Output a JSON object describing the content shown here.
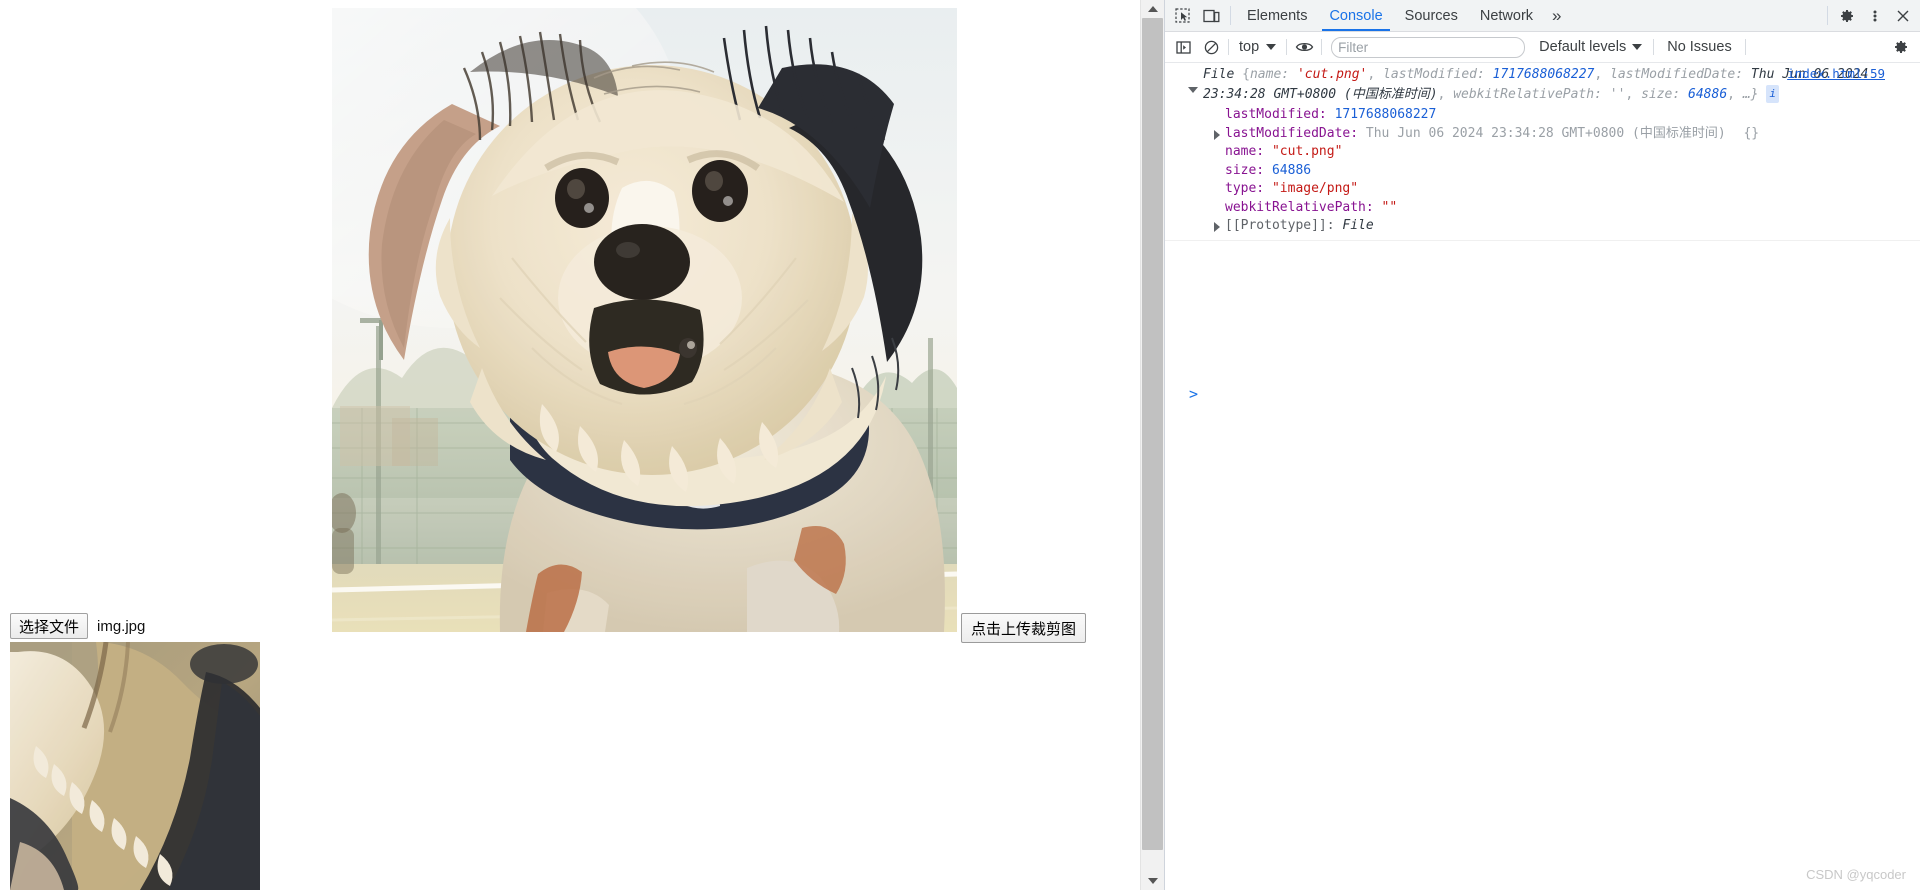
{
  "page": {
    "file_input": {
      "button_label": "选择文件",
      "file_name": "img.jpg"
    },
    "upload_button_label": "点击上传裁剪图",
    "main_image_alt": "cropped-dog-photo",
    "preview_image_alt": "cropped-preview"
  },
  "devtools": {
    "tabs": [
      {
        "label": "Elements",
        "active": false
      },
      {
        "label": "Console",
        "active": true
      },
      {
        "label": "Sources",
        "active": false
      },
      {
        "label": "Network",
        "active": false
      }
    ],
    "more_tabs_label": "»",
    "icons": {
      "inspect": "inspect-element-icon",
      "device": "device-toolbar-icon",
      "settings": "gear-icon",
      "kebab": "more-options-icon",
      "close": "close-icon",
      "sidebar": "console-sidebar-icon",
      "clear": "clear-console-icon",
      "eye": "live-expression-icon",
      "console_settings": "console-settings-gear-icon"
    },
    "console_toolbar": {
      "context": "top",
      "filter_placeholder": "Filter",
      "filter_value": "",
      "levels": "Default levels",
      "issues": "No Issues"
    },
    "console": {
      "source_link": "index.html:59",
      "summary": {
        "constructor": "File",
        "open_brace": "{",
        "k_name": "name:",
        "v_name": "'cut.png'",
        "sep1": ",",
        "k_lastModified": "lastModified:",
        "v_lastModified": "1717688068227",
        "sep2": ",",
        "k_lastModifiedDate": "lastModifiedDate:",
        "v_lastModifiedDate": "Thu Jun 06 2024 23:34:28 GMT+0800 (中国标准时间)",
        "sep3": ",",
        "k_webkitRelativePath": "webkitRelativePath:",
        "v_webkitRelativePath": "''",
        "sep4": ",",
        "k_size": "size:",
        "v_size": "64886",
        "sep5": ",",
        "ellipsis": "…}",
        "badge": "i"
      },
      "properties": [
        {
          "name": "lastModified:",
          "value": "1717688068227",
          "value_class": "v-num",
          "expandable": false,
          "suffix": ""
        },
        {
          "name": "lastModifiedDate:",
          "value": "Thu Jun 06 2024 23:34:28 GMT+0800 (中国标准时间)",
          "value_class": "v-date",
          "expandable": true,
          "suffix": "{}"
        },
        {
          "name": "name:",
          "value": "\"cut.png\"",
          "value_class": "v-str",
          "expandable": false,
          "suffix": ""
        },
        {
          "name": "size:",
          "value": "64886",
          "value_class": "v-num",
          "expandable": false,
          "suffix": ""
        },
        {
          "name": "type:",
          "value": "\"image/png\"",
          "value_class": "v-str",
          "expandable": false,
          "suffix": ""
        },
        {
          "name": "webkitRelativePath:",
          "value": "\"\"",
          "value_class": "v-str",
          "expandable": false,
          "suffix": ""
        },
        {
          "name": "[[Prototype]]:",
          "value": "File",
          "value_class": "prop-proto",
          "expandable": true,
          "suffix": ""
        }
      ],
      "prompt": ">"
    }
  },
  "watermark": "CSDN @yqcoder",
  "colors": {
    "accent_blue": "#1a73e8",
    "tabbar_bg": "#f1f3f4",
    "string_red": "#c41a16",
    "number_blue": "#1a5fd6",
    "prop_purple": "#881391",
    "muted_grey": "#9aa0a6"
  }
}
